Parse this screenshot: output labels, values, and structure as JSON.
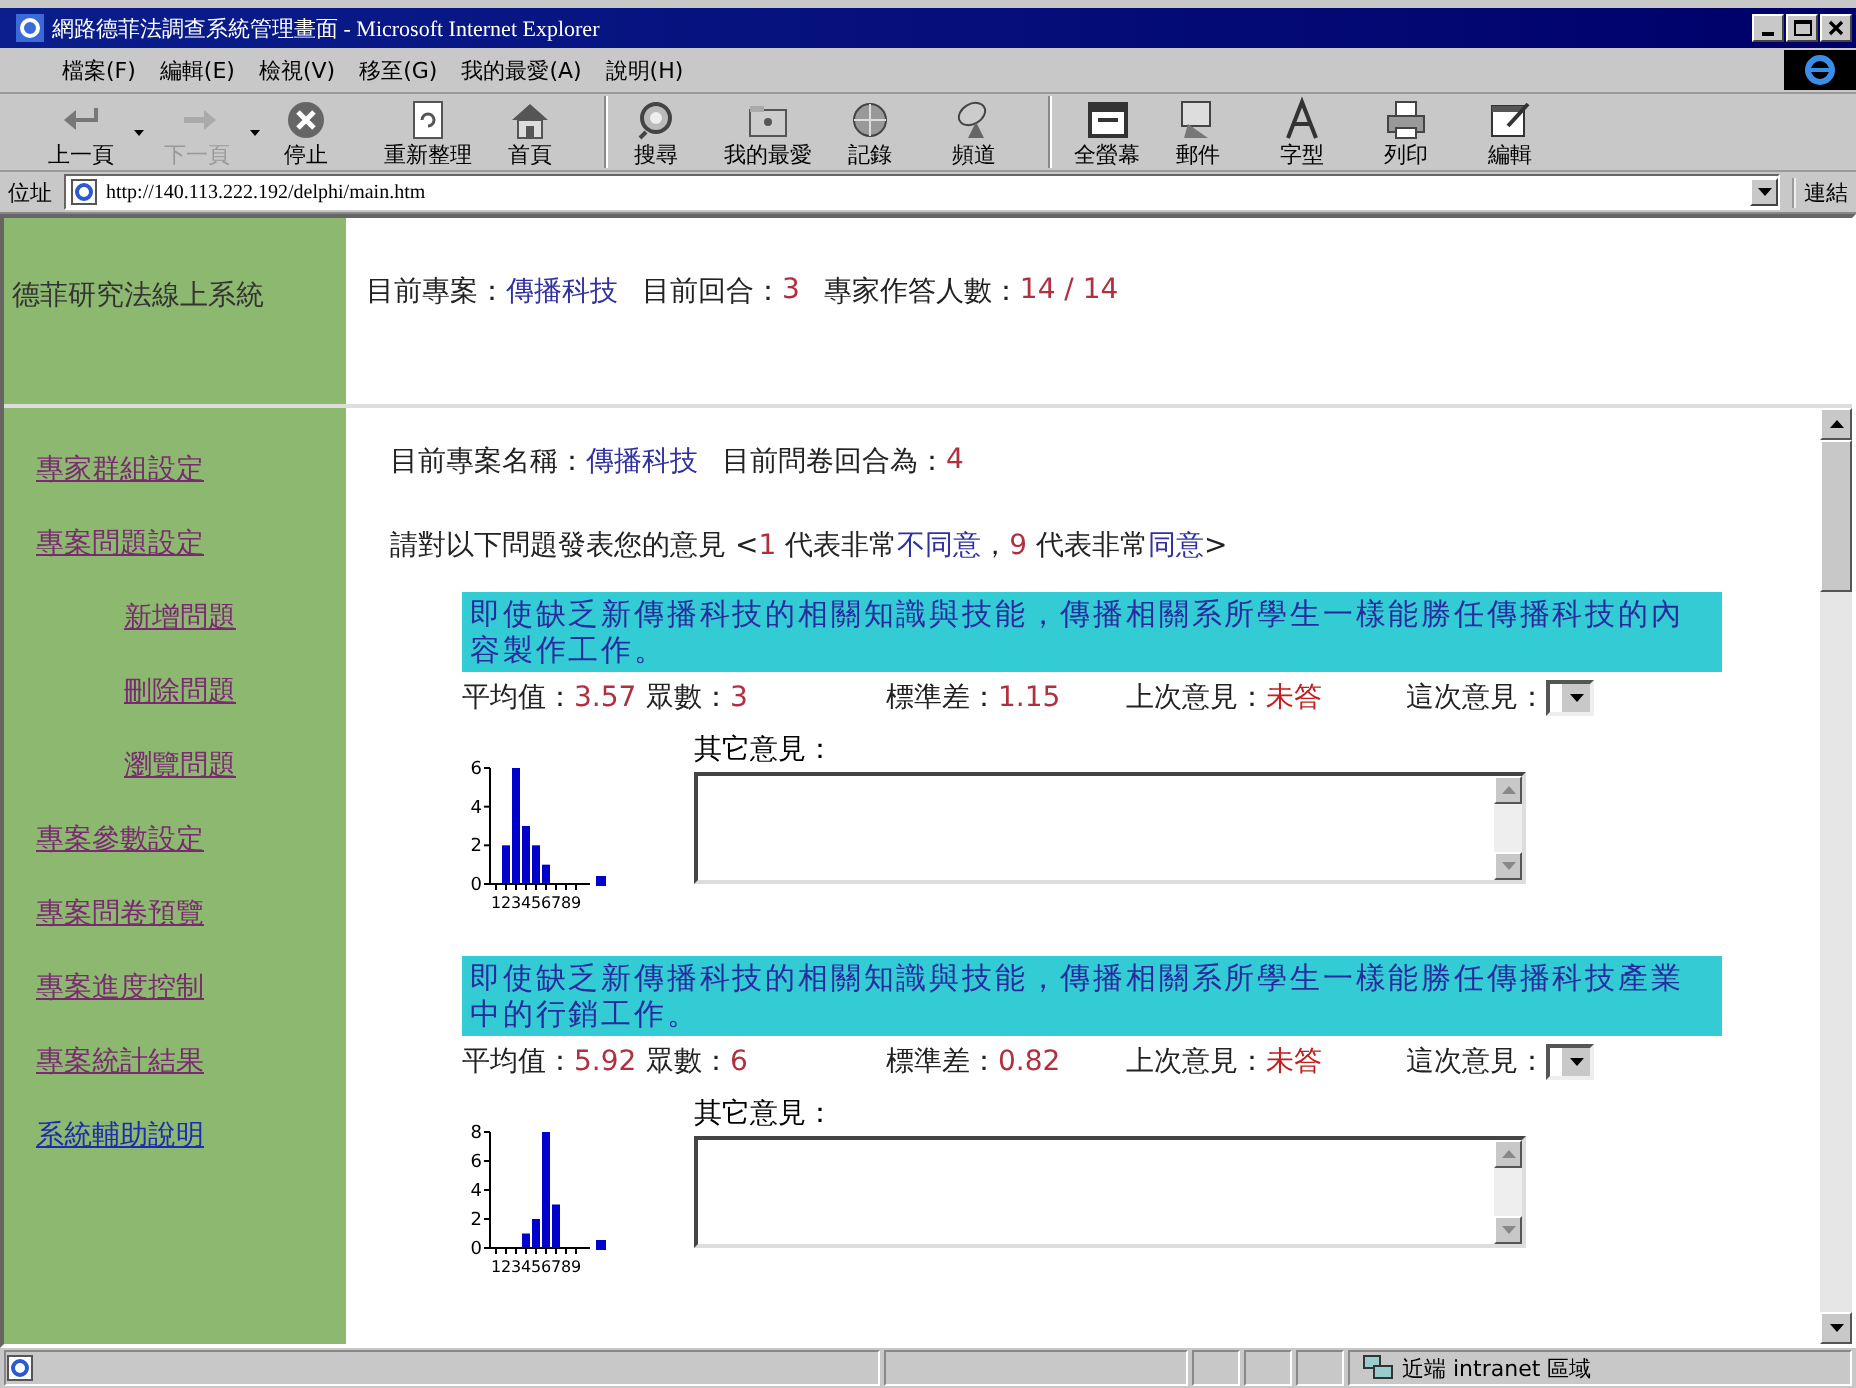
{
  "window": {
    "title": "網路德菲法調查系統管理畫面 - Microsoft Internet Explorer"
  },
  "menu": [
    "檔案(F)",
    "編輯(E)",
    "檢視(V)",
    "移至(G)",
    "我的最愛(A)",
    "說明(H)"
  ],
  "toolbar": [
    {
      "kind": "back",
      "label": "上一頁",
      "dropdown": true,
      "disabled": false,
      "separator_before": false
    },
    {
      "kind": "forward",
      "label": "下一頁",
      "dropdown": true,
      "disabled": true,
      "separator_before": false
    },
    {
      "kind": "stop",
      "label": "停止",
      "dropdown": false,
      "disabled": false,
      "separator_before": false
    },
    {
      "kind": "refresh",
      "label": "重新整理",
      "dropdown": false,
      "disabled": false,
      "separator_before": false
    },
    {
      "kind": "home",
      "label": "首頁",
      "dropdown": false,
      "disabled": false,
      "separator_before": false
    },
    {
      "kind": "search",
      "label": "搜尋",
      "dropdown": false,
      "disabled": false,
      "separator_before": true
    },
    {
      "kind": "favorites",
      "label": "我的最愛",
      "dropdown": false,
      "disabled": false,
      "separator_before": false
    },
    {
      "kind": "history",
      "label": "記錄",
      "dropdown": false,
      "disabled": false,
      "separator_before": false
    },
    {
      "kind": "channels",
      "label": "頻道",
      "dropdown": false,
      "disabled": false,
      "separator_before": false
    },
    {
      "kind": "fullscreen",
      "label": "全螢幕",
      "dropdown": false,
      "disabled": false,
      "separator_before": true
    },
    {
      "kind": "mail",
      "label": "郵件",
      "dropdown": false,
      "disabled": false,
      "separator_before": false
    },
    {
      "kind": "font",
      "label": "字型",
      "dropdown": false,
      "disabled": false,
      "separator_before": false
    },
    {
      "kind": "print",
      "label": "列印",
      "dropdown": false,
      "disabled": false,
      "separator_before": false
    },
    {
      "kind": "edit",
      "label": "編輯",
      "dropdown": false,
      "disabled": false,
      "separator_before": false
    }
  ],
  "address": {
    "label": "位址",
    "value": "http://140.113.222.192/delphi/main.htm",
    "links_label": "連結"
  },
  "header": {
    "system_title": "德菲研究法線上系統",
    "fields": [
      {
        "label": "目前專案：",
        "value": "傳播科技",
        "kind": "name"
      },
      {
        "label": "目前回合：",
        "value": "3",
        "kind": "number"
      },
      {
        "label": "專家作答人數：",
        "value": "14 / 14",
        "kind": "number"
      }
    ]
  },
  "sidebar": {
    "items": [
      {
        "label": "專家群組設定",
        "visited": true
      },
      {
        "label": "專案問題設定",
        "visited": true,
        "children": [
          {
            "label": "新增問題",
            "visited": true
          },
          {
            "label": "刪除問題",
            "visited": true
          },
          {
            "label": "瀏覽問題",
            "visited": true
          }
        ]
      },
      {
        "label": "專案參數設定",
        "visited": true
      },
      {
        "label": "專案問卷預覽",
        "visited": true
      },
      {
        "label": "專案進度控制",
        "visited": true
      },
      {
        "label": "專案統計結果",
        "visited": true
      },
      {
        "label": "系統輔助說明",
        "visited": false
      }
    ]
  },
  "project_info": [
    {
      "label": "目前專案名稱：",
      "value": "傳播科技",
      "kind": "name"
    },
    {
      "label": "目前問卷回合為：",
      "value": "4",
      "kind": "number"
    }
  ],
  "instruction": [
    {
      "text": "請對以下問題發表您的意見 <",
      "kind": "plain"
    },
    {
      "text": "1",
      "kind": "number"
    },
    {
      "text": " 代表非常",
      "kind": "plain"
    },
    {
      "text": "不同意",
      "kind": "name"
    },
    {
      "text": "，",
      "kind": "plain"
    },
    {
      "text": "9",
      "kind": "number"
    },
    {
      "text": " 代表非常",
      "kind": "plain"
    },
    {
      "text": "同意",
      "kind": "name"
    },
    {
      "text": ">",
      "kind": "plain"
    }
  ],
  "questions": [
    {
      "text": "即使缺乏新傳播科技的相關知識與技能，傳播相關系所學生一樣能勝任傳播科技的內容製作工作。",
      "stats": [
        {
          "label": "平均值：",
          "value": "3.57"
        },
        {
          "label": "眾數：",
          "value": "3"
        },
        {
          "label": "標準差：",
          "value": "1.15"
        },
        {
          "label": "上次意見：",
          "value": "未答"
        }
      ],
      "this_opinion_label": "這次意見：",
      "other_label": "其它意見：",
      "chart_data": {
        "type": "bar",
        "categories": [
          "1",
          "2",
          "3",
          "4",
          "5",
          "6",
          "7",
          "8",
          "9"
        ],
        "series": [
          {
            "color": "#0000cc",
            "values": [
              0,
              2,
              6,
              3,
              2,
              1,
              0,
              0,
              0
            ]
          }
        ],
        "ylim": [
          0,
          6
        ],
        "yticks": [
          0,
          2,
          4,
          6
        ]
      }
    },
    {
      "text": "即使缺乏新傳播科技的相關知識與技能，傳播相關系所學生一樣能勝任傳播科技產業中的行銷工作。",
      "stats": [
        {
          "label": "平均值：",
          "value": "5.92"
        },
        {
          "label": "眾數：",
          "value": "6"
        },
        {
          "label": "標準差：",
          "value": "0.82"
        },
        {
          "label": "上次意見：",
          "value": "未答"
        }
      ],
      "this_opinion_label": "這次意見：",
      "other_label": "其它意見：",
      "chart_data": {
        "type": "bar",
        "categories": [
          "1",
          "2",
          "3",
          "4",
          "5",
          "6",
          "7",
          "8",
          "9"
        ],
        "series": [
          {
            "color": "#0000cc",
            "values": [
              0,
              0,
              0,
              1,
              2,
              8,
              3,
              0,
              0
            ]
          }
        ],
        "ylim": [
          0,
          8
        ],
        "yticks": [
          0,
          2,
          4,
          6,
          8
        ]
      }
    }
  ],
  "status_bar": {
    "zone": "近端 intranet 區域"
  }
}
